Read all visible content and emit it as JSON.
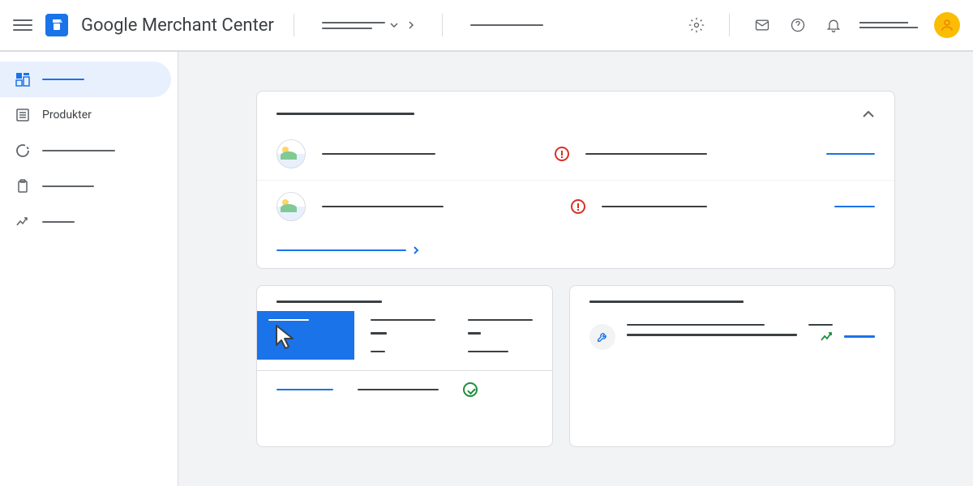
{
  "header": {
    "app_title": "Google Merchant Center"
  },
  "sidebar": {
    "items": [
      {
        "label_hidden": true,
        "active": true
      },
      {
        "label": "Produkter",
        "active": false
      },
      {
        "label_hidden": true,
        "active": false
      },
      {
        "label_hidden": true,
        "active": false
      },
      {
        "label_hidden": true,
        "active": false
      }
    ]
  },
  "overview_card": {
    "title_placeholder": true,
    "rows": [
      {
        "has_thumb": true,
        "has_error": true
      },
      {
        "has_thumb": true,
        "has_error": true
      }
    ],
    "footer_link_placeholder": true
  }
}
